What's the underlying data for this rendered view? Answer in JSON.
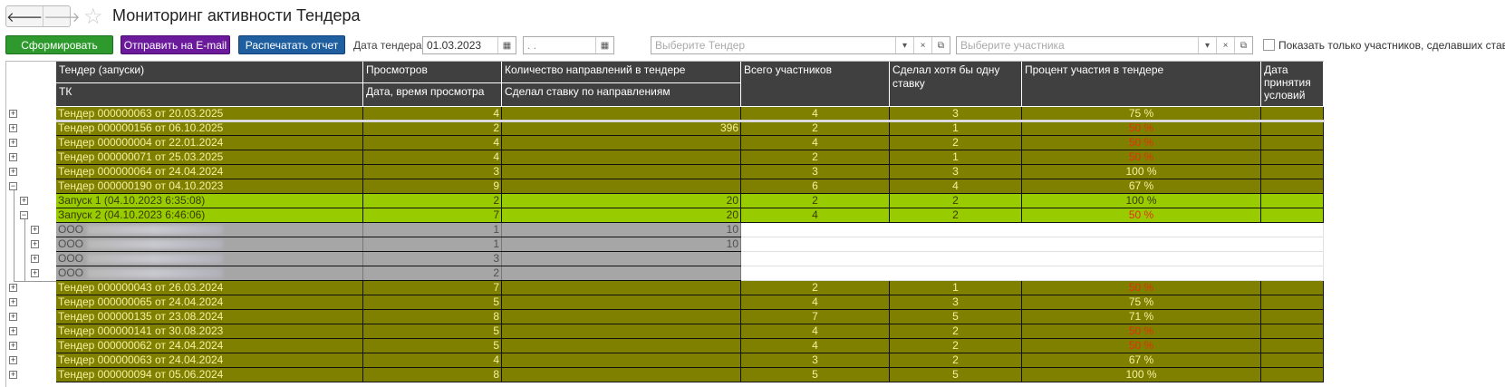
{
  "window": {
    "title": "Мониторинг активности Тендера",
    "back_icon": "arrow-left",
    "forward_icon": "arrow-right",
    "favorite_icon": "star"
  },
  "toolbar": {
    "generate": "Сформировать",
    "email": "Отправить на E-mail",
    "print": "Распечатать отчет",
    "date_label": "Дата тендера:",
    "date_from": "01.03.2023",
    "date_to": ". .",
    "tender_placeholder": "Выберите Тендер",
    "participant_placeholder": "Выберите участника",
    "only_bidders_label": "Показать только участников, сделавших ставки",
    "only_bidders_checked": false
  },
  "colors": {
    "generate": "#2e9a2e",
    "email": "#6a1a9a",
    "print": "#1f5f9f",
    "tender_row": "#808000",
    "launch_row": "#99cc00",
    "org_row": "#a6a6a6",
    "header": "#404040",
    "low_percent": "#e03010"
  },
  "table": {
    "headers": {
      "tender": "Тендер (запуски)",
      "tk": "ТК",
      "views": "Просмотров",
      "view_time": "Дата, время просмотра",
      "directions": "Количество направлений в тендере",
      "bid_directions": "Сделал ставку по направлениям",
      "total": "Всего участников",
      "bid_once": "Сделал хотя бы одну ставку",
      "percent": "Процент участия в тендере",
      "accept_date": "Дата принятия условий"
    },
    "rows": [
      {
        "type": "tender",
        "exp": "plus",
        "name": "Тендер 000000063 от 20.03.2025",
        "views": "4",
        "dirs": "",
        "total": "4",
        "bid": "3",
        "pct": "75 %",
        "low": false
      },
      {
        "type": "tender",
        "exp": "plus",
        "name": "Тендер 000000156 от 06.10.2025",
        "views": "2",
        "dirs": "396",
        "total": "2",
        "bid": "1",
        "pct": "50 %",
        "low": true
      },
      {
        "type": "tender",
        "exp": "plus",
        "name": "Тендер 000000004 от 22.01.2024",
        "views": "4",
        "dirs": "",
        "total": "4",
        "bid": "2",
        "pct": "50 %",
        "low": true
      },
      {
        "type": "tender",
        "exp": "plus",
        "name": "Тендер 000000071 от 25.03.2025",
        "views": "4",
        "dirs": "",
        "total": "2",
        "bid": "1",
        "pct": "50 %",
        "low": true
      },
      {
        "type": "tender",
        "exp": "plus",
        "name": "Тендер 000000064 от 24.04.2024",
        "views": "3",
        "dirs": "",
        "total": "3",
        "bid": "3",
        "pct": "100 %",
        "low": false
      },
      {
        "type": "tender",
        "exp": "minus",
        "name": "Тендер 000000190 от 04.10.2023",
        "views": "9",
        "dirs": "",
        "total": "6",
        "bid": "4",
        "pct": "67 %",
        "low": false
      },
      {
        "type": "launch",
        "exp": "plus",
        "name": "Запуск 1 (04.10.2023 6:35:08)",
        "views": "2",
        "dirs": "20",
        "total": "2",
        "bid": "2",
        "pct": "100 %",
        "low": false
      },
      {
        "type": "launch",
        "exp": "minus",
        "name": "Запуск 2 (04.10.2023 6:46:06)",
        "views": "7",
        "dirs": "20",
        "total": "4",
        "bid": "2",
        "pct": "50 %",
        "low": true
      },
      {
        "type": "org",
        "exp": "plus",
        "name": "ООО",
        "views": "1",
        "dirs": "10"
      },
      {
        "type": "org",
        "exp": "plus",
        "name": "ООО",
        "views": "1",
        "dirs": "10"
      },
      {
        "type": "org",
        "exp": "plus",
        "name": "ООО",
        "views": "3",
        "dirs": ""
      },
      {
        "type": "org",
        "exp": "plus",
        "name": "ООО",
        "views": "2",
        "dirs": ""
      },
      {
        "type": "tender",
        "exp": "plus",
        "name": "Тендер 000000043 от 26.03.2024",
        "views": "7",
        "dirs": "",
        "total": "2",
        "bid": "1",
        "pct": "50 %",
        "low": true
      },
      {
        "type": "tender",
        "exp": "plus",
        "name": "Тендер 000000065 от 24.04.2024",
        "views": "5",
        "dirs": "",
        "total": "4",
        "bid": "3",
        "pct": "75 %",
        "low": false
      },
      {
        "type": "tender",
        "exp": "plus",
        "name": "Тендер 000000135 от 23.08.2024",
        "views": "8",
        "dirs": "",
        "total": "7",
        "bid": "5",
        "pct": "71 %",
        "low": false
      },
      {
        "type": "tender",
        "exp": "plus",
        "name": "Тендер 000000141 от 30.08.2023",
        "views": "5",
        "dirs": "",
        "total": "4",
        "bid": "2",
        "pct": "50 %",
        "low": true
      },
      {
        "type": "tender",
        "exp": "plus",
        "name": "Тендер 000000062 от 24.04.2024",
        "views": "5",
        "dirs": "",
        "total": "4",
        "bid": "2",
        "pct": "50 %",
        "low": true
      },
      {
        "type": "tender",
        "exp": "plus",
        "name": "Тендер 000000063 от 24.04.2024",
        "views": "4",
        "dirs": "",
        "total": "3",
        "bid": "2",
        "pct": "67 %",
        "low": false
      },
      {
        "type": "tender",
        "exp": "plus",
        "name": "Тендер 000000094 от 05.06.2024",
        "views": "8",
        "dirs": "",
        "total": "5",
        "bid": "5",
        "pct": "100 %",
        "low": false
      }
    ]
  }
}
